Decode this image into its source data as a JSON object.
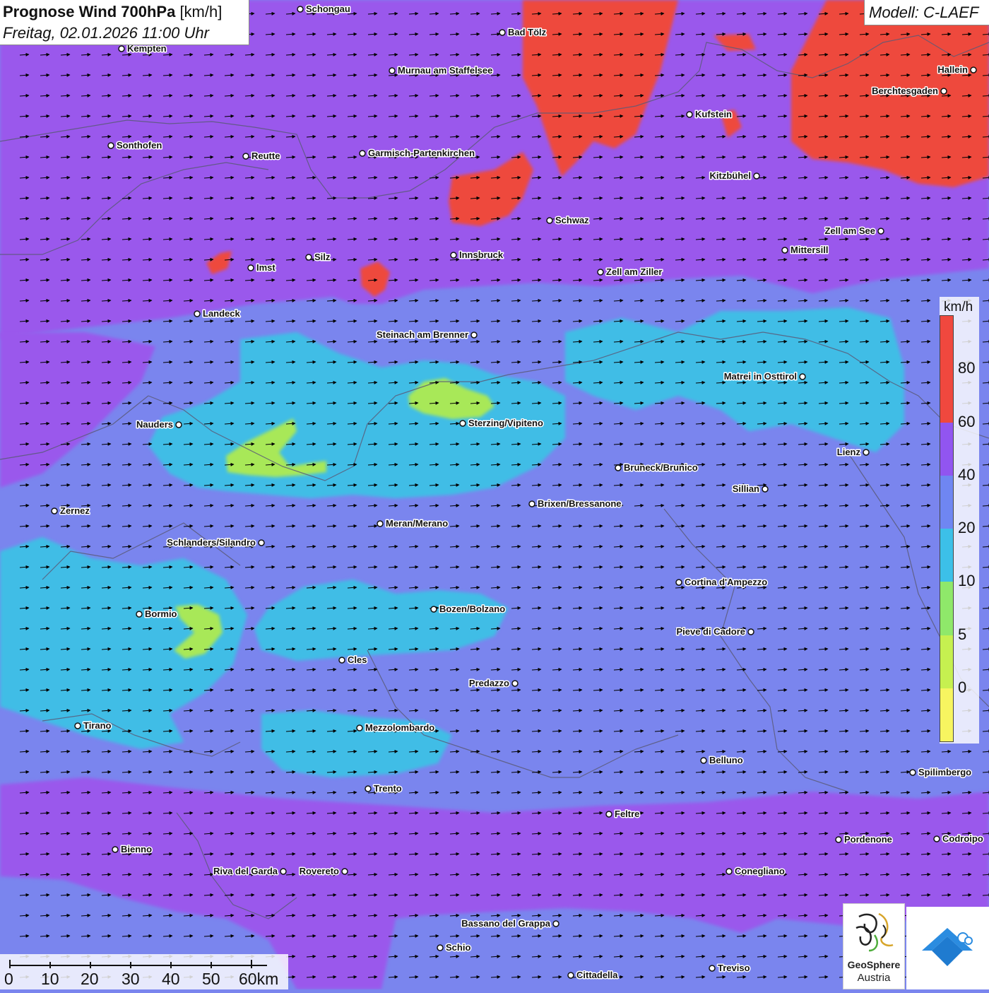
{
  "header": {
    "title_bold": "Prognose Wind 700hPa",
    "title_unit": "[km/h]",
    "subtitle": "Freitag, 02.01.2026 11:00 Uhr",
    "model": "Modell: C-LAEF"
  },
  "legend": {
    "unit": "km/h",
    "classes": [
      {
        "label": "80",
        "color": "#f0483e"
      },
      {
        "label": "60",
        "color": "#9155f0"
      },
      {
        "label": "40",
        "color": "#6f86f2"
      },
      {
        "label": "20",
        "color": "#3cc0e8"
      },
      {
        "label": "10",
        "color": "#8fe86a"
      },
      {
        "label": "5",
        "color": "#c6f050"
      },
      {
        "label": "0",
        "color": "#f7f560"
      }
    ],
    "top_color": "#f0483e"
  },
  "scale_bar": {
    "labels": [
      "0",
      "10",
      "20",
      "30",
      "40",
      "50",
      "60km"
    ]
  },
  "wind": {
    "direction": "east"
  },
  "cities": [
    {
      "name": "Schongau"
    },
    {
      "name": "Bad Tölz"
    },
    {
      "name": "Kempten"
    },
    {
      "name": "Murnau am Staffelsee"
    },
    {
      "name": "Hallein"
    },
    {
      "name": "Berchtesgaden"
    },
    {
      "name": "Kufstein"
    },
    {
      "name": "Sonthofen"
    },
    {
      "name": "Reutte"
    },
    {
      "name": "Garmisch-Partenkirchen"
    },
    {
      "name": "Kitzbühel"
    },
    {
      "name": "Schwaz"
    },
    {
      "name": "Zell am See"
    },
    {
      "name": "Mittersill"
    },
    {
      "name": "Innsbruck"
    },
    {
      "name": "Silz"
    },
    {
      "name": "Imst"
    },
    {
      "name": "Zell am Ziller"
    },
    {
      "name": "Landeck"
    },
    {
      "name": "Steinach am Brenner"
    },
    {
      "name": "Matrei in Osttirol"
    },
    {
      "name": "Nauders"
    },
    {
      "name": "Sterzing/Vipiteno"
    },
    {
      "name": "Lienz"
    },
    {
      "name": "Bruneck/Brunico"
    },
    {
      "name": "Sillian"
    },
    {
      "name": "Brixen/Bressanone"
    },
    {
      "name": "Zernez"
    },
    {
      "name": "Meran/Merano"
    },
    {
      "name": "Schlanders/Silandro"
    },
    {
      "name": "Cortina d'Ampezzo"
    },
    {
      "name": "Bozen/Bolzano"
    },
    {
      "name": "Bormio"
    },
    {
      "name": "Pieve di Cadore"
    },
    {
      "name": "Cles"
    },
    {
      "name": "Predazzo"
    },
    {
      "name": "Tirano"
    },
    {
      "name": "Mezzolombardo"
    },
    {
      "name": "Belluno"
    },
    {
      "name": "Spilimbergo"
    },
    {
      "name": "Trento"
    },
    {
      "name": "Feltre"
    },
    {
      "name": "Pordenone"
    },
    {
      "name": "Codroipo"
    },
    {
      "name": "Bienno"
    },
    {
      "name": "Riva del Garda"
    },
    {
      "name": "Rovereto"
    },
    {
      "name": "Conegliano"
    },
    {
      "name": "Bassano del Grappa"
    },
    {
      "name": "Schio"
    },
    {
      "name": "Treviso"
    },
    {
      "name": "Cittadella"
    }
  ],
  "logos": {
    "geosphere_line1": "GeoSphere",
    "geosphere_line2": "Austria"
  }
}
